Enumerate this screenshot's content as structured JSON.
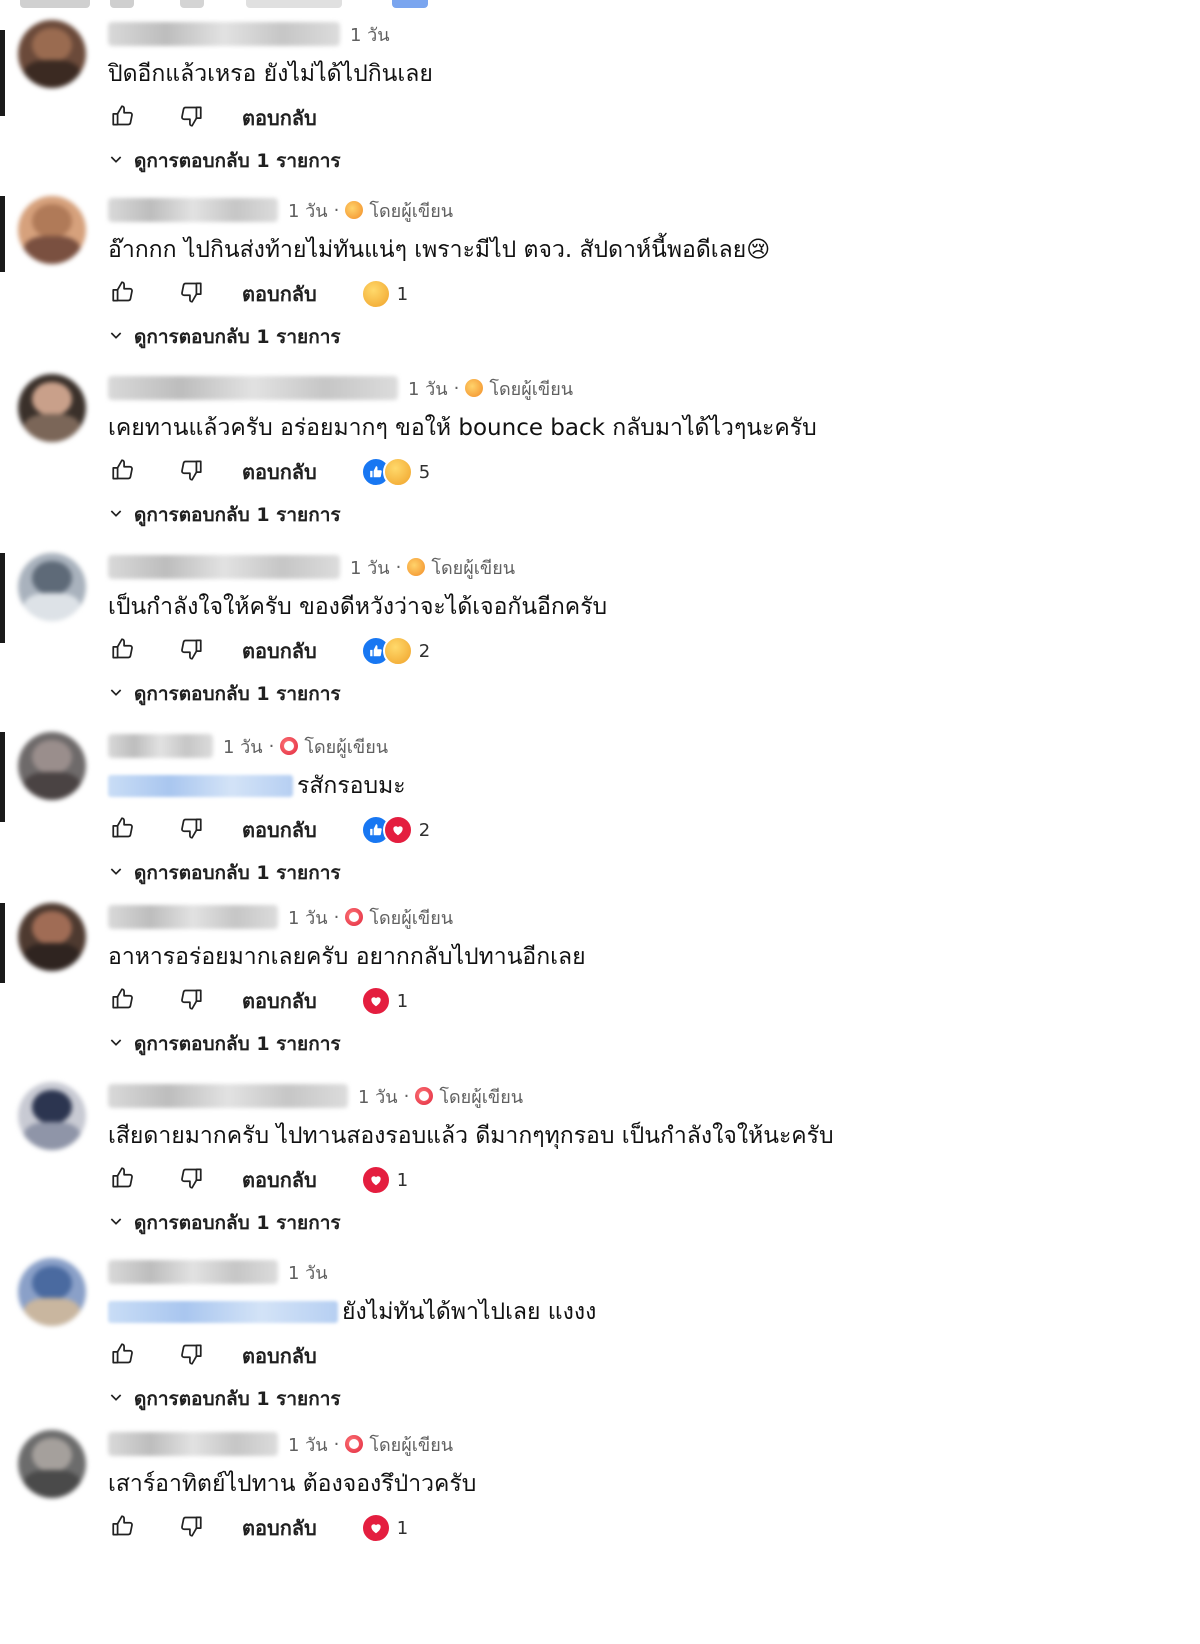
{
  "labels": {
    "reply": "ตอบกลับ",
    "view_replies": "ดูการตอบกลับ 1 รายการ",
    "author_heart": "โดยผู้เขียน"
  },
  "colors": {
    "like_blue": "#1877f2",
    "heart_red": "#e41e3f",
    "secondary_text": "#606060"
  },
  "comments": [
    {
      "time": "1 วัน",
      "author_heart": false,
      "text": "ปิดอีกแล้วเหรอ ยังไม่ได้ไปกินเลย",
      "reactions": [],
      "reaction_count": "",
      "has_replies": true
    },
    {
      "time": "1 วัน",
      "author_heart": true,
      "heart_icon": "hug-emoji",
      "text": "อ๊ากกก ไปกินส่งท้ายไม่ทันแน่ๆ เพราะมีไป ตจว. สัปดาห์นี้พอดีเลย😢",
      "reactions": [
        "hug"
      ],
      "reaction_count": "1",
      "has_replies": true
    },
    {
      "time": "1 วัน",
      "author_heart": true,
      "heart_icon": "hug-emoji",
      "text": "เคยทานแล้วครับ อร่อยมากๆ ขอให้ bounce back กลับมาได้ไวๆนะครับ",
      "reactions": [
        "like",
        "hug"
      ],
      "reaction_count": "5",
      "has_replies": true
    },
    {
      "time": "1 วัน",
      "author_heart": true,
      "heart_icon": "hug-emoji",
      "text": "เป็นกำลังใจให้ครับ ของดีหวังว่าจะได้เจอกันอีกครับ",
      "reactions": [
        "like",
        "hug"
      ],
      "reaction_count": "2",
      "has_replies": true
    },
    {
      "time": "1 วัน",
      "author_heart": true,
      "heart_icon": "heart",
      "text": "รสักรอบมะ",
      "link_blur_before": true,
      "reactions": [
        "like",
        "heart"
      ],
      "reaction_count": "2",
      "has_replies": true
    },
    {
      "time": "1 วัน",
      "author_heart": true,
      "heart_icon": "heart",
      "text": "อาหารอร่อยมากเลยครับ อยากกลับไปทานอีกเลย",
      "reactions": [
        "heart"
      ],
      "reaction_count": "1",
      "has_replies": true
    },
    {
      "time": "1 วัน",
      "author_heart": true,
      "heart_icon": "heart",
      "text": "เสียดายมากครับ ไปทานสองรอบแล้ว ดีมากๆทุกรอบ เป็นกำลังใจให้นะครับ",
      "reactions": [
        "heart"
      ],
      "reaction_count": "1",
      "has_replies": true
    },
    {
      "time": "1 วัน",
      "author_heart": false,
      "text": "ยังไม่ทันได้พาไปเลย แงงง",
      "link_blur_before": true,
      "reactions": [],
      "reaction_count": "",
      "has_replies": true
    },
    {
      "time": "1 วัน",
      "author_heart": true,
      "heart_icon": "heart",
      "text": "เสาร์อาทิตย์ไปทาน ต้องจองรึป่าวครับ",
      "reactions": [
        "heart"
      ],
      "reaction_count": "1",
      "has_replies": false
    }
  ]
}
